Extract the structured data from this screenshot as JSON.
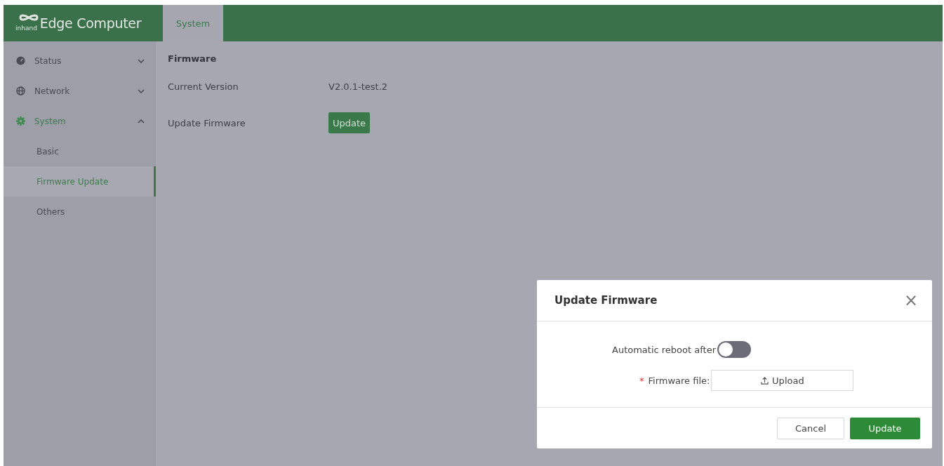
{
  "header": {
    "logo_text": "inhand",
    "title": "Edge Computer",
    "tabs": [
      {
        "label": "System",
        "selected": true
      }
    ]
  },
  "sidebar": {
    "items": [
      {
        "label": "Status",
        "expanded": false,
        "selected": false
      },
      {
        "label": "Network",
        "expanded": false,
        "selected": false
      },
      {
        "label": "System",
        "expanded": true,
        "selected": true,
        "children": [
          {
            "label": "Basic",
            "selected": false
          },
          {
            "label": "Firmware Update",
            "selected": true
          },
          {
            "label": "Others",
            "selected": false
          }
        ]
      }
    ]
  },
  "content": {
    "title": "Firmware",
    "rows": [
      {
        "label": "Current Version",
        "kind": "text",
        "value": "V2.0.1-test.2"
      },
      {
        "label": "Update Firmware",
        "kind": "button",
        "value": "Update"
      }
    ]
  },
  "dialog": {
    "title": "Update Firmware",
    "close": "×",
    "reboot": {
      "label": "Automatic reboot after",
      "on": false
    },
    "file": {
      "required": "*",
      "label": "Firmware file:",
      "button": "Upload"
    },
    "buttons": [
      {
        "label": "Cancel",
        "kind": "secondary"
      },
      {
        "label": "Update",
        "kind": "primary"
      }
    ]
  }
}
